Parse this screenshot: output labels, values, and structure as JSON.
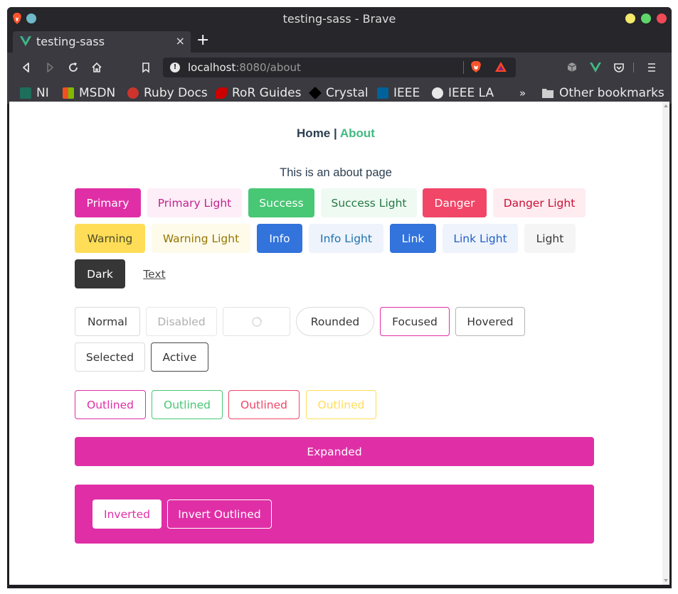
{
  "browser": {
    "window_title": "testing-sass - Brave",
    "tab_title": "testing-sass",
    "tab_close": "×",
    "new_tab": "+",
    "url_host": "localhost",
    "url_path": ":8080/about",
    "info_glyph": "!",
    "bookmarks": [
      "NI",
      "MSDN",
      "Ruby Docs",
      "RoR Guides",
      "Crystal",
      "IEEE",
      "IEEE LA"
    ],
    "bookmarks_overflow": "»",
    "other_bookmarks": "Other bookmarks"
  },
  "nav": {
    "home": "Home",
    "separator": "|",
    "about": "About"
  },
  "page": {
    "about_text": "This is an about page"
  },
  "colors_row": {
    "primary": "Primary",
    "primary_light": "Primary Light",
    "success": "Success",
    "success_light": "Success Light",
    "danger": "Danger",
    "danger_light": "Danger Light",
    "warning": "Warning",
    "warning_light": "Warning Light",
    "info": "Info",
    "info_light": "Info Light",
    "link": "Link",
    "link_light": "Link Light",
    "light": "Light",
    "dark": "Dark",
    "text": "Text"
  },
  "states_row": {
    "normal": "Normal",
    "disabled": "Disabled",
    "rounded": "Rounded",
    "focused": "Focused",
    "hovered": "Hovered",
    "selected": "Selected",
    "active": "Active"
  },
  "outlined_row": {
    "primary": "Outlined",
    "success": "Outlined",
    "danger": "Outlined",
    "warning": "Outlined"
  },
  "expanded": "Expanded",
  "inverted_row": {
    "inverted": "Inverted",
    "invert_outlined": "Invert Outlined"
  },
  "theme": {
    "primary": "#e02fa6",
    "success": "#48c774",
    "danger": "#f14668",
    "warning": "#ffdd57",
    "info": "#3273dc",
    "dark": "#363636",
    "vue_green": "#42b983"
  },
  "icons": [
    "brave-icon",
    "vue-icon",
    "back-icon",
    "forward-icon",
    "reload-icon",
    "home-icon",
    "bookmark-icon",
    "info-icon",
    "brave-shield-icon",
    "rewards-icon",
    "extension-icon",
    "pocket-icon",
    "menu-icon",
    "folder-icon",
    "loading-spinner-icon"
  ]
}
